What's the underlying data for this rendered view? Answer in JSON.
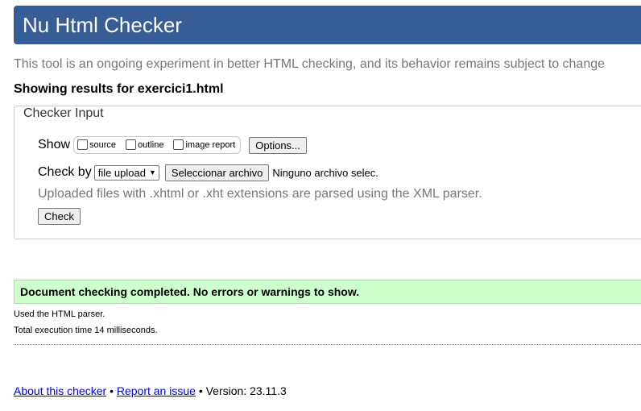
{
  "header": {
    "title": "Nu Html Checker"
  },
  "subtitle": "This tool is an ongoing experiment in better HTML checking, and its behavior remains subject to change",
  "showing": "Showing results for exercici1.html",
  "checker_input": {
    "legend": "Checker Input",
    "show_label": "Show",
    "options": [
      {
        "label": "source",
        "checked": false
      },
      {
        "label": "outline",
        "checked": false
      },
      {
        "label": "image report",
        "checked": false
      }
    ],
    "options_button": "Options...",
    "check_by_label": "Check by",
    "check_by_value": "file upload",
    "file_button": "Seleccionar archivo",
    "file_status": "Ninguno archivo selec.",
    "hint": "Uploaded files with .xhtml or .xht extensions are parsed using the XML parser.",
    "check_button": "Check"
  },
  "result": {
    "success_message": "Document checking completed. No errors or warnings to show.",
    "parser_info": "Used the HTML parser.",
    "time_info": "Total execution time 14 milliseconds."
  },
  "footer": {
    "about_link": "About this checker",
    "sep1": "•",
    "report_link": "Report an issue",
    "sep2": "•",
    "version": "Version: 23.11.3"
  },
  "colors": {
    "header_bg": "#365d95",
    "success_bg": "#ccffcc",
    "link": "#0000ee"
  }
}
